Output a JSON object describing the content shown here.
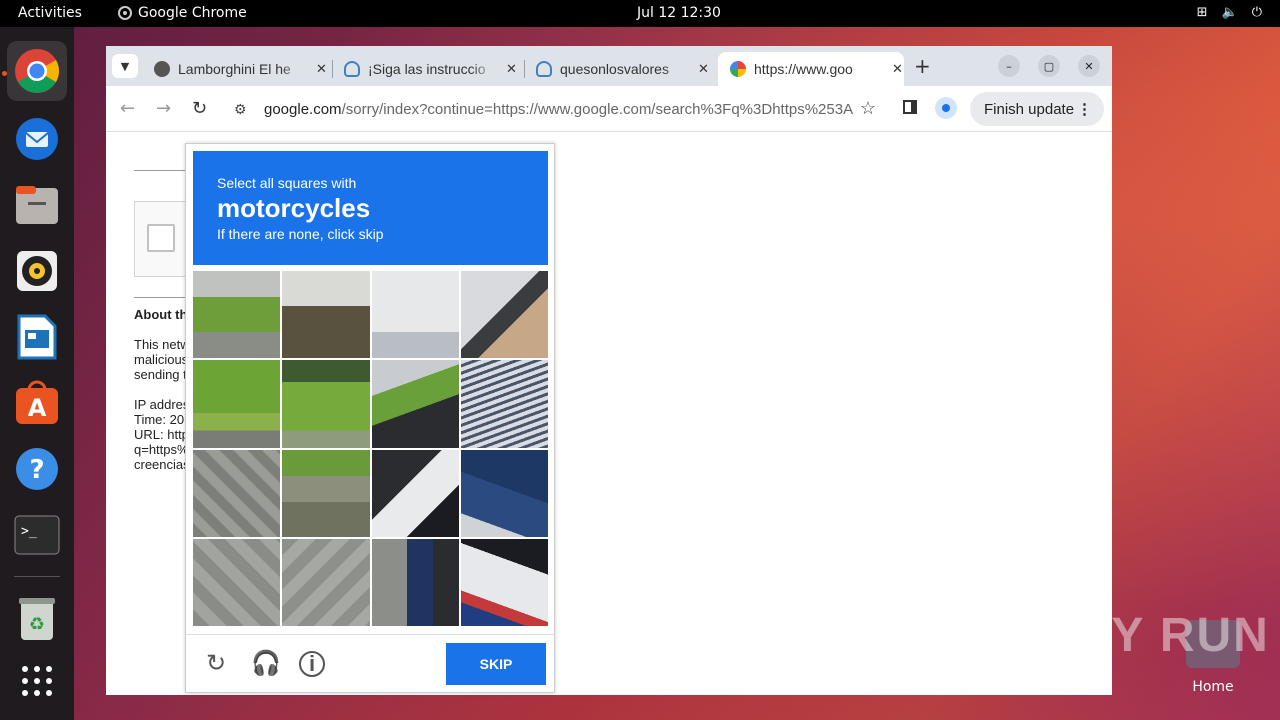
{
  "topbar": {
    "activities": "Activities",
    "app_name": "Google Chrome",
    "clock": "Jul 12  12:30",
    "tray_icons": [
      "network-icon",
      "volume-icon",
      "power-icon"
    ]
  },
  "dock": {
    "items": [
      "chrome-icon",
      "thunderbird-icon",
      "files-icon",
      "rhythmbox-icon",
      "writer-icon",
      "app-center-icon",
      "help-icon",
      "terminal-icon",
      "trash-icon",
      "app-grid-icon"
    ]
  },
  "desktop": {
    "home_label": "Home",
    "watermark": "ANY RUN"
  },
  "browser": {
    "tabs": [
      {
        "title": "Lamborghini El he",
        "close": "✕"
      },
      {
        "title": "¡Siga las instruccio",
        "close": "✕"
      },
      {
        "title": "quesonlosvalores",
        "close": "✕"
      },
      {
        "title": "https://www.goo",
        "close": "✕"
      }
    ],
    "new_tab": "+",
    "url_host": "google.com",
    "url_rest": "/sorry/index?continue=https://www.google.com/search%3Fq%3Dhttps%253A...",
    "finish_update": "Finish update",
    "colors": {
      "accent": "#1a73e8",
      "tabbar": "#dee3ea"
    }
  },
  "page": {
    "about_heading": "About th",
    "para1": [
      "This netw",
      "malicious",
      "sending t"
    ],
    "para2": [
      "IP addres",
      "Time: 20",
      "URL: http",
      "q=https%",
      "creencias"
    ]
  },
  "captcha": {
    "instruction": "Select all squares with",
    "target": "motorcycles",
    "hint": "If there are none, click skip",
    "skip_label": "SKIP",
    "footer_icons": [
      "reload-icon",
      "audio-icon",
      "info-icon"
    ]
  }
}
